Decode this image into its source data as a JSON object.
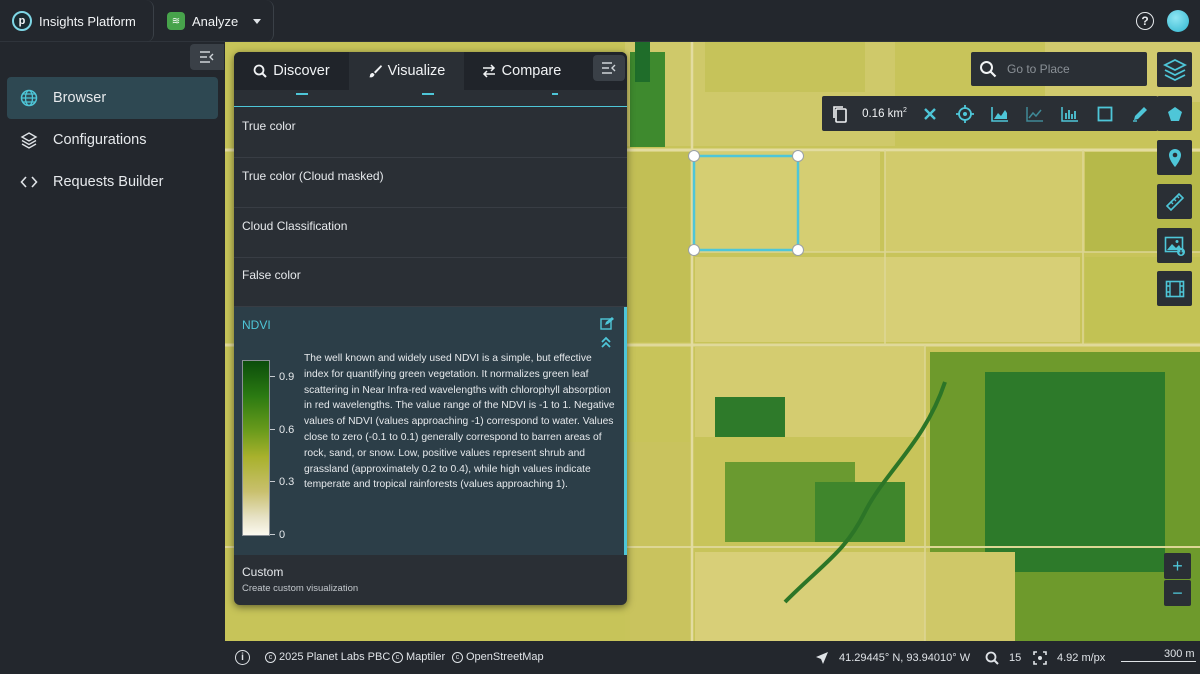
{
  "header": {
    "brand": "Insights Platform",
    "brand_logo_letter": "p",
    "app_switch": "Analyze"
  },
  "sidebar": {
    "items": [
      {
        "label": "Browser",
        "active": true
      },
      {
        "label": "Configurations",
        "active": false
      },
      {
        "label": "Requests Builder",
        "active": false
      }
    ]
  },
  "panel": {
    "tabs": [
      {
        "label": "Discover",
        "active": false
      },
      {
        "label": "Visualize",
        "active": true
      },
      {
        "label": "Compare",
        "active": false
      }
    ],
    "items": [
      "True color",
      "True color (Cloud masked)",
      "Cloud Classification",
      "False color"
    ],
    "ndvi": {
      "title": "NDVI",
      "legend_labels": [
        "0.9",
        "0.6",
        "0.3",
        "0"
      ],
      "description": "The well known and widely used NDVI is a simple, but effective index for quantifying green vegetation. It normalizes green leaf scattering in Near Infra-red wavelengths with chlorophyll absorption in red wavelengths. The value range of the NDVI is -1 to 1. Negative values of NDVI (values approaching -1) correspond to water. Values close to zero (-0.1 to 0.1) generally correspond to barren areas of rock, sand, or snow. Low, positive values represent shrub and grassland (approximately 0.2 to 0.4), while high values indicate temperate and tropical rainforests (values approaching 1)."
    },
    "custom": {
      "title": "Custom",
      "subtitle": "Create custom visualization"
    }
  },
  "map": {
    "search_placeholder": "Go to Place",
    "area_value": "0.16 km",
    "area_sup": "2",
    "zoom_in": "+",
    "zoom_out": "−"
  },
  "footer": {
    "attributions": [
      "2025 Planet Labs PBC",
      "Maptiler",
      "OpenStreetMap"
    ],
    "coordinates": "41.29445° N, 93.94010° W",
    "zoom": "15",
    "resolution": "4.92 m/px",
    "scale": "300 m"
  },
  "colors": {
    "accent": "#4ec6d8",
    "background": "#23272d",
    "panel": "#2a2f35",
    "active_nav": "#2e4852"
  }
}
